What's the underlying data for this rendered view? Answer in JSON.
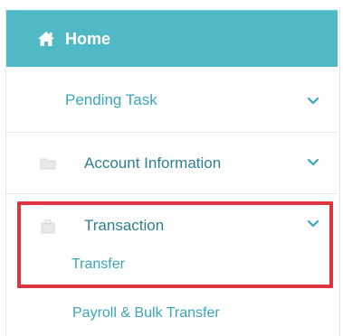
{
  "sidebar": {
    "home": {
      "label": "Home",
      "icon": "home-icon",
      "background": "#4fb9c5"
    },
    "items": [
      {
        "label": "Pending Task",
        "icon": null,
        "chevron": "chevron-down-icon"
      },
      {
        "label": "Account Information",
        "icon": "folder-icon",
        "chevron": "chevron-down-icon"
      },
      {
        "label": "Transaction",
        "icon": "folder-icon",
        "chevron": "chevron-down-icon",
        "expanded": true,
        "children": [
          {
            "label": "Transfer",
            "highlighted": true
          },
          {
            "label": "Payroll & Bulk Transfer"
          }
        ]
      }
    ]
  },
  "colors": {
    "accent": "#4fb9c5",
    "link_text": "#3aa6b7",
    "highlight_border": "#e0343f"
  }
}
